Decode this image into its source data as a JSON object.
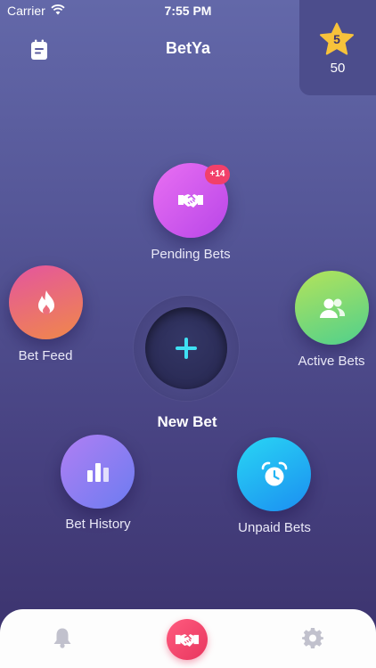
{
  "status_bar": {
    "carrier": "Carrier",
    "time": "7:55 PM"
  },
  "header": {
    "title": "BetYa",
    "left_icon": "calendar-icon"
  },
  "points": {
    "level": "5",
    "value": "50",
    "icon": "star-icon",
    "star_color": "#f7c23b"
  },
  "menu": {
    "pending": {
      "label": "Pending Bets",
      "badge": "+14",
      "icon": "handshake-icon"
    },
    "feed": {
      "label": "Bet Feed",
      "icon": "flame-icon"
    },
    "active": {
      "label": "Active Bets",
      "icon": "users-icon"
    },
    "new_bet": {
      "label": "New Bet",
      "icon": "plus-icon",
      "accent": "#3fe0f3"
    },
    "history": {
      "label": "Bet History",
      "icon": "bar-chart-icon"
    },
    "unpaid": {
      "label": "Unpaid Bets",
      "icon": "alarm-clock-icon"
    }
  },
  "tab_bar": {
    "left_icon": "bell-icon",
    "center_icon": "handshake-icon",
    "right_icon": "gear-icon"
  }
}
